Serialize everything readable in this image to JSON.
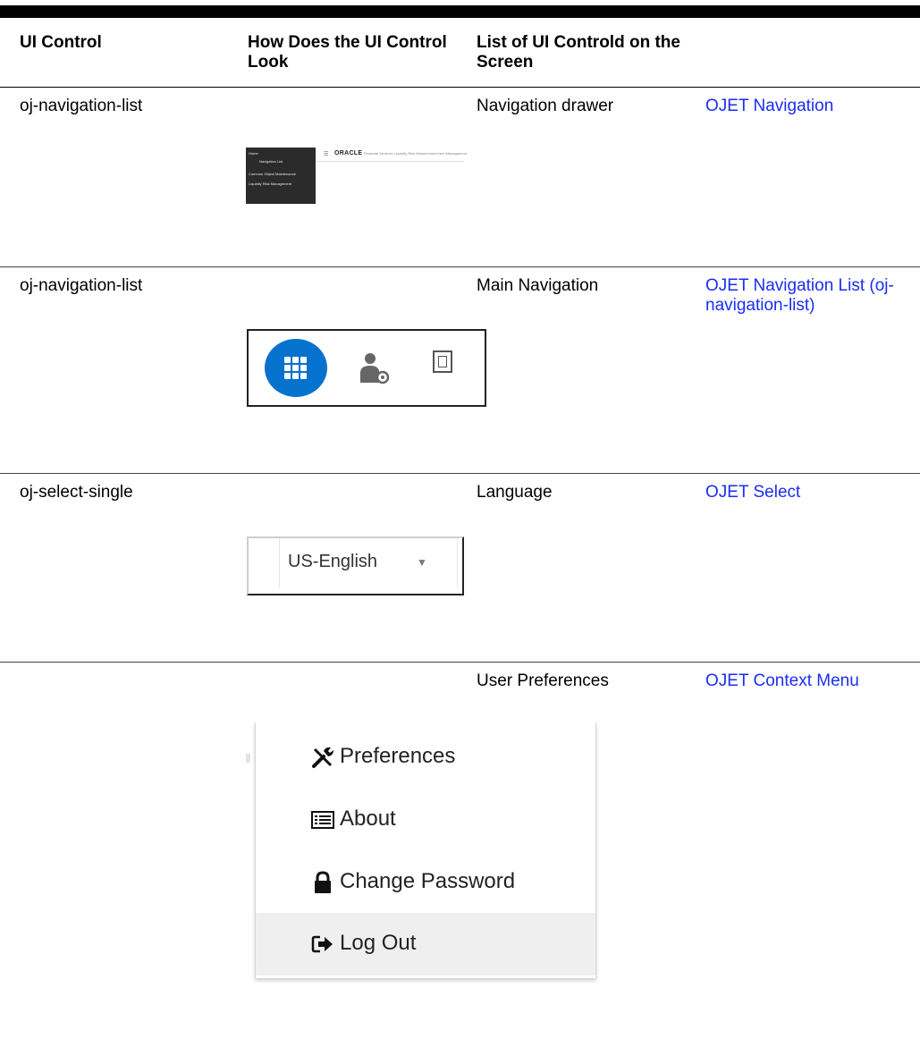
{
  "table": {
    "headers": [
      "UI Control",
      "How Does the UI Control Look",
      "List of UI Controld on the Screen",
      ""
    ],
    "rows": [
      {
        "control": "oj-navigation-list",
        "screen_item": "Navigation drawer",
        "link": "OJET Navigation"
      },
      {
        "control": "oj-navigation-list",
        "screen_item": "Main Navigation",
        "link": "OJET Navigation List (oj-navigation-list)"
      },
      {
        "control": "oj-select-single",
        "screen_item": "Language",
        "link": "OJET Select"
      },
      {
        "control": "",
        "screen_item": "User Preferences",
        "link": "OJET Context Menu"
      }
    ]
  },
  "drawer_preview": {
    "lines": [
      "Home",
      "Navigation List",
      "Common Object Maintenance",
      "Liquidity Risk Management"
    ],
    "brand": "ORACLE",
    "product": "Financial Services Liquidity Risk Measurement and Management"
  },
  "main_nav_preview": {
    "icons": [
      "apps-grid-icon",
      "user-settings-icon",
      "report-icon"
    ],
    "active_color": "#0572ce"
  },
  "language_preview": {
    "value": "US-English"
  },
  "context_menu_preview": {
    "items": [
      {
        "label": "Preferences",
        "icon": "tools-icon"
      },
      {
        "label": "About",
        "icon": "list-icon"
      },
      {
        "label": "Change Password",
        "icon": "lock-icon"
      },
      {
        "label": "Log Out",
        "icon": "logout-icon"
      }
    ]
  },
  "colors": {
    "link": "#1a2ef0",
    "rule": "#000000"
  }
}
